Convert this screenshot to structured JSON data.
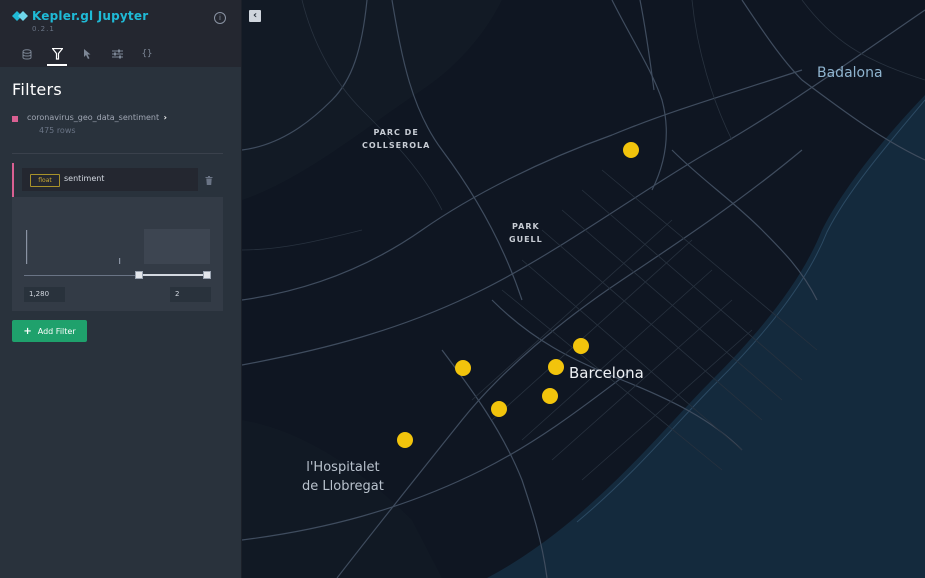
{
  "app": {
    "title": "Kepler.gl Jupyter",
    "version": "0.2.1"
  },
  "tabs": [
    {
      "name": "layers",
      "icon": "layers-icon"
    },
    {
      "name": "filters",
      "icon": "filter-icon",
      "active": true
    },
    {
      "name": "interactions",
      "icon": "pointer-icon"
    },
    {
      "name": "basemap",
      "icon": "sliders-icon"
    },
    {
      "name": "config",
      "icon": "braces-icon"
    }
  ],
  "panel": {
    "title": "Filters",
    "dataset": {
      "name": "coronavirus_geo_data_sentiment",
      "rows": "475 rows",
      "color": "#d96092"
    },
    "filter": {
      "type_badge": "float",
      "field": "sentiment",
      "range_min": "1,280",
      "range_max": "2",
      "selection_start": 0.62,
      "selection_end": 1.0
    },
    "add_filter_label": "Add Filter"
  },
  "map": {
    "labels": {
      "badalona": "Badalona",
      "parc_line1": "PARC DE",
      "parc_line2": "COLLSEROLA",
      "park_line1": "PARK",
      "park_line2": "GUELL",
      "barcelona": "Barcelona",
      "hospitalet_line1": "l'Hospitalet",
      "hospitalet_line2": "de Llobregat"
    },
    "point_color": "#f2c40c",
    "water_color": "#142a3d",
    "land_color": "#0f1622"
  }
}
